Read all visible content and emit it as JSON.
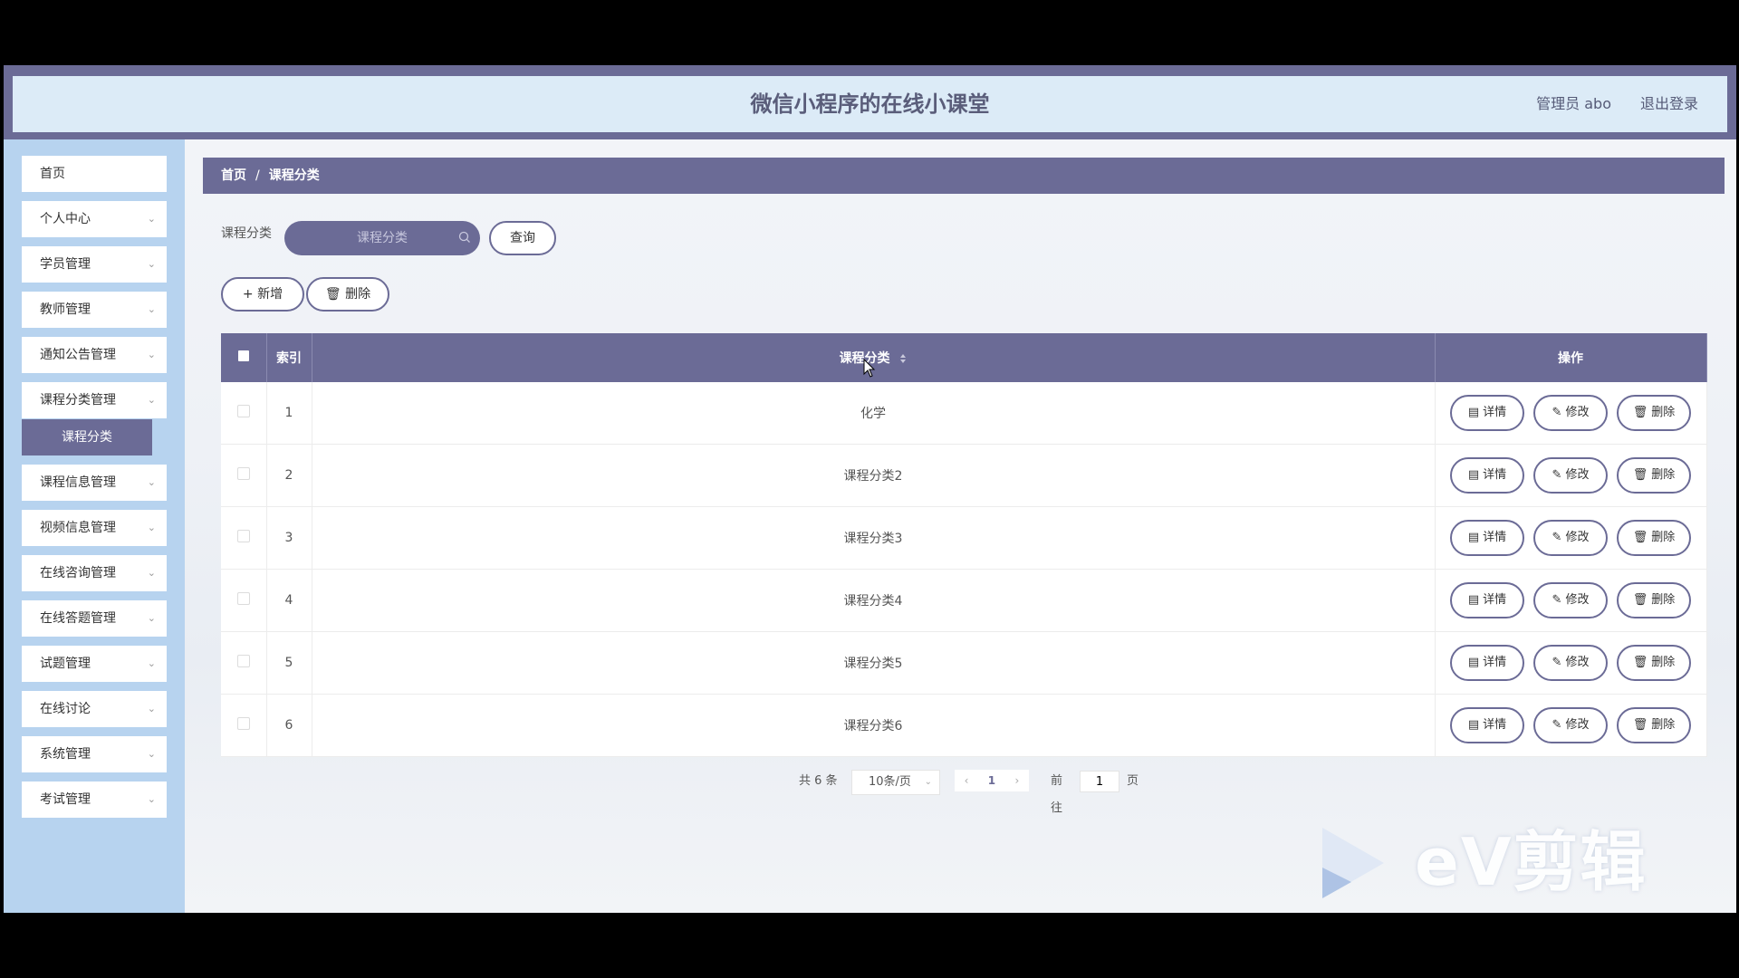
{
  "header": {
    "title": "微信小程序的在线小课堂",
    "user_label": "管理员 abo",
    "logout_label": "退出登录"
  },
  "sidebar": {
    "items": [
      {
        "label": "首页",
        "has_children": false
      },
      {
        "label": "个人中心",
        "has_children": true
      },
      {
        "label": "学员管理",
        "has_children": true
      },
      {
        "label": "教师管理",
        "has_children": true
      },
      {
        "label": "通知公告管理",
        "has_children": true
      },
      {
        "label": "课程分类管理",
        "has_children": true,
        "expanded": true
      },
      {
        "label": "课程信息管理",
        "has_children": true
      },
      {
        "label": "视频信息管理",
        "has_children": true
      },
      {
        "label": "在线咨询管理",
        "has_children": true
      },
      {
        "label": "在线答题管理",
        "has_children": true
      },
      {
        "label": "试题管理",
        "has_children": true
      },
      {
        "label": "在线讨论",
        "has_children": true
      },
      {
        "label": "系统管理",
        "has_children": true
      },
      {
        "label": "考试管理",
        "has_children": true
      }
    ],
    "active_sub_item": "课程分类"
  },
  "breadcrumb": {
    "home": "首页",
    "separator": "/",
    "current": "课程分类"
  },
  "search": {
    "label": "课程分类",
    "placeholder": "课程分类",
    "value": "",
    "button_label": "查询"
  },
  "toolbar": {
    "add_label": "新增",
    "delete_label": "删除"
  },
  "table": {
    "columns": {
      "index": "索引",
      "category": "课程分类",
      "actions": "操作"
    },
    "rows": [
      {
        "index": "1",
        "category": "化学"
      },
      {
        "index": "2",
        "category": "课程分类2"
      },
      {
        "index": "3",
        "category": "课程分类3"
      },
      {
        "index": "4",
        "category": "课程分类4"
      },
      {
        "index": "5",
        "category": "课程分类5"
      },
      {
        "index": "6",
        "category": "课程分类6"
      }
    ],
    "row_actions": {
      "detail": "详情",
      "edit": "修改",
      "delete": "删除"
    }
  },
  "pagination": {
    "total_text": "共 6 条",
    "page_size": "10条/页",
    "current_page": "1",
    "goto_label": "前往",
    "goto_value": "1",
    "page_suffix": "页"
  },
  "watermark": {
    "text": "eV剪辑"
  },
  "colors": {
    "primary": "#6b6b96",
    "header_bg": "#dcebf7",
    "sidebar_bg": "#b7d3ef"
  }
}
